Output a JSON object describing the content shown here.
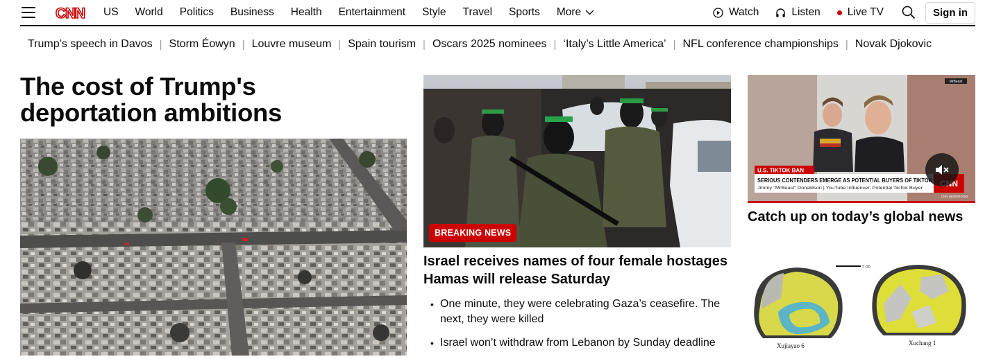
{
  "header": {
    "menu_icon": "hamburger-icon",
    "logo_text": "CNN",
    "nav": [
      "US",
      "World",
      "Politics",
      "Business",
      "Health",
      "Entertainment",
      "Style",
      "Travel",
      "Sports"
    ],
    "more_label": "More",
    "watch_label": "Watch",
    "listen_label": "Listen",
    "live_tv_label": "Live TV",
    "sign_in_label": "Sign in",
    "brand_color": "#cc0000"
  },
  "trending": [
    "Trump’s speech in Davos",
    "Storm Éowyn",
    "Louvre museum",
    "Spain tourism",
    "Oscars 2025 nominees",
    "‘Italy’s Little America’",
    "NFL conference championships",
    "Novak Djokovic"
  ],
  "lead": {
    "headline_line1": "The cost of Trump's",
    "headline_line2": "deportation ambitions"
  },
  "center": {
    "badge": "BREAKING NEWS",
    "headline": "Israel receives names of four female hostages Hamas will release Saturday",
    "bullets": [
      "One minute, they were celebrating Gaza’s ceasefire. The next, they were killed",
      "Israel won’t withdraw from Lebanon by Sunday deadline"
    ]
  },
  "right": {
    "video": {
      "corner_tag": "MrBeast",
      "lower_third_label": "U.S. TIKTOK BAN",
      "lower_third_headline": "SERIOUS CONTENDERS EMERGE AS POTENTIAL BUYERS OF TIKTOK",
      "lower_third_sub": "Jimmy \"MrBeast\" Donaldson  |  YouTube Influencer, Potential TikTok Buyer",
      "logo": "CNN",
      "newsroom_tag": "CNN NEWSROOM"
    },
    "headline": "Catch up on today’s global news",
    "figure": {
      "scale_label": "5 cm",
      "left_caption": "Xujiayao 6",
      "right_caption": "Xuchang 1"
    }
  }
}
